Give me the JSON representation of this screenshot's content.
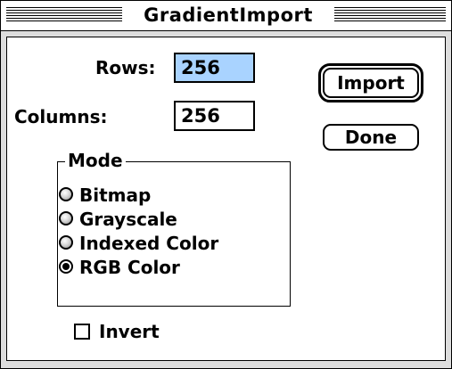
{
  "window": {
    "title": "GradientImport"
  },
  "fields": {
    "rows_label": "Rows:",
    "rows_value": "256",
    "columns_label": "Columns:",
    "columns_value": "256"
  },
  "buttons": {
    "import_label": "Import",
    "done_label": "Done"
  },
  "mode": {
    "title": "Mode",
    "options": [
      {
        "label": "Bitmap",
        "selected": false
      },
      {
        "label": "Grayscale",
        "selected": false
      },
      {
        "label": "Indexed Color",
        "selected": false
      },
      {
        "label": "RGB Color",
        "selected": true
      }
    ]
  },
  "invert": {
    "label": "Invert",
    "checked": false
  },
  "colors": {
    "selection_highlight": "#a9d3ff",
    "frame": "#dddddd"
  }
}
